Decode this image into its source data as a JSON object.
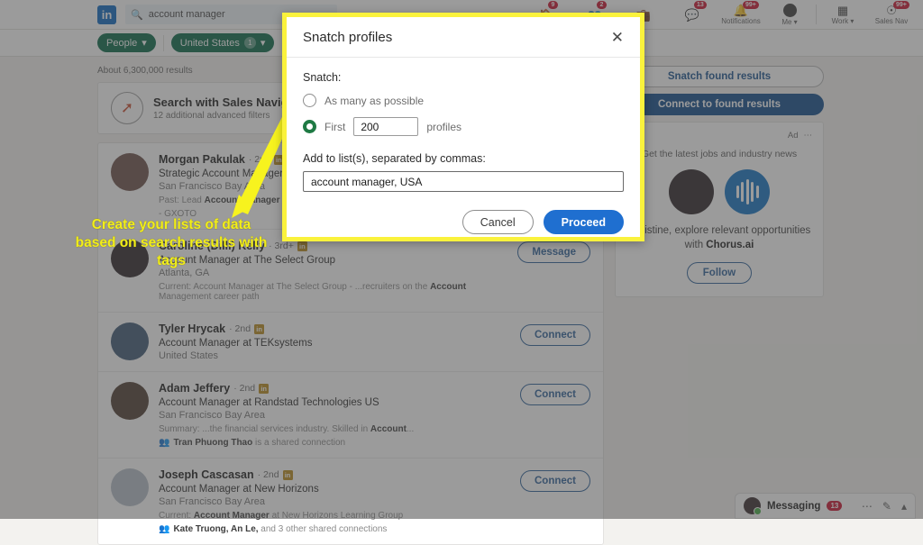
{
  "header": {
    "logo": "in",
    "search_value": "account manager",
    "search_icon": "search-icon",
    "nav": [
      {
        "label": "",
        "icon": "home-icon",
        "badge": "9"
      },
      {
        "label": "",
        "icon": "network-icon",
        "badge": "2"
      },
      {
        "label": "",
        "icon": "jobs-icon",
        "badge": ""
      },
      {
        "label": "",
        "icon": "messaging-icon",
        "badge": "13"
      },
      {
        "label": "Notifications",
        "icon": "bell-icon",
        "badge": "99+"
      },
      {
        "label": "Me",
        "icon": "avatar-icon",
        "badge": ""
      },
      {
        "label": "Work",
        "icon": "grid-icon",
        "badge": ""
      },
      {
        "label": "Sales Nav",
        "icon": "compass-icon",
        "badge": "99+"
      }
    ]
  },
  "filters": {
    "people": "People",
    "location": "United States",
    "location_count": "1"
  },
  "results": {
    "count_text": "About 6,300,000 results",
    "salesnav_title": "Search with Sales Navigator",
    "salesnav_sub": "12 additional advanced filters",
    "profiles": [
      {
        "name": "Morgan Pakulak",
        "degree": "2nd",
        "title": "Strategic Account Manager at Co",
        "location": "San Francisco Bay Area",
        "meta_prefix": "Past: Lead ",
        "meta_bold": "Account Manager",
        "meta_suffix": " at Colla",
        "extra": "- GXOTO",
        "action": ""
      },
      {
        "name": "Caroline (Dilli) Kelly",
        "degree": "3rd+",
        "title": "Account Manager at The Select Group",
        "location": "Atlanta, GA",
        "meta_prefix": "Current: Account Manager at The Select Group - ...recruiters on the ",
        "meta_bold": "Account",
        "meta_suffix": " Management career path",
        "extra": "",
        "action": "Message"
      },
      {
        "name": "Tyler Hrycak",
        "degree": "2nd",
        "title": "Account Manager at TEKsystems",
        "location": "United States",
        "meta_prefix": "",
        "meta_bold": "",
        "meta_suffix": "",
        "extra": "",
        "action": "Connect"
      },
      {
        "name": "Adam Jeffery",
        "degree": "2nd",
        "title": "Account Manager at Randstad Technologies US",
        "location": "San Francisco Bay Area",
        "meta_prefix": "Summary: ...the financial services industry. Skilled in ",
        "meta_bold": "Account",
        "meta_suffix": "...",
        "shared_bold": "Tran Phuong Thao",
        "shared_rest": " is a shared connection",
        "extra": "",
        "action": "Connect"
      },
      {
        "name": "Joseph Cascasan",
        "degree": "2nd",
        "title": "Account Manager at New Horizons",
        "location": "San Francisco Bay Area",
        "meta_prefix": "Current: ",
        "meta_bold": "Account Manager",
        "meta_suffix": " at New Horizons Learning Group",
        "shared_bold": "Kate Truong, An Le,",
        "shared_rest": " and 3 other shared connections",
        "extra": "",
        "action": "Connect"
      }
    ]
  },
  "sidebar": {
    "snatch_button": "Snatch found results",
    "connect_button": "Connect to found results",
    "ad_label": "Ad",
    "ad_menu_icon": "ellipsis-icon",
    "ad_sub": "Get the latest jobs and industry news",
    "ad_text_prefix": "Christine, explore relevant opportunities with ",
    "ad_text_bold": "Chorus.ai",
    "follow_button": "Follow"
  },
  "messaging": {
    "title": "Messaging",
    "badge": "13",
    "icons": [
      "ellipsis-icon",
      "compose-icon",
      "chevron-up-icon"
    ]
  },
  "annotation": {
    "text": "Create your lists of data based on search results with tags",
    "color": "#f2ee1a"
  },
  "modal": {
    "title": "Snatch profiles",
    "close_icon": "close-icon",
    "snatch_label": "Snatch:",
    "option_all": "As many as possible",
    "option_first": "First",
    "profiles_suffix": "profiles",
    "count_value": "200",
    "list_label": "Add to list(s), separated by commas:",
    "list_value": "account manager, USA",
    "cancel_button": "Cancel",
    "proceed_button": "Proceed",
    "accent_color": "#1f6fd0",
    "border_color": "#faf23c",
    "radio_selected_color": "#1f7a44"
  }
}
